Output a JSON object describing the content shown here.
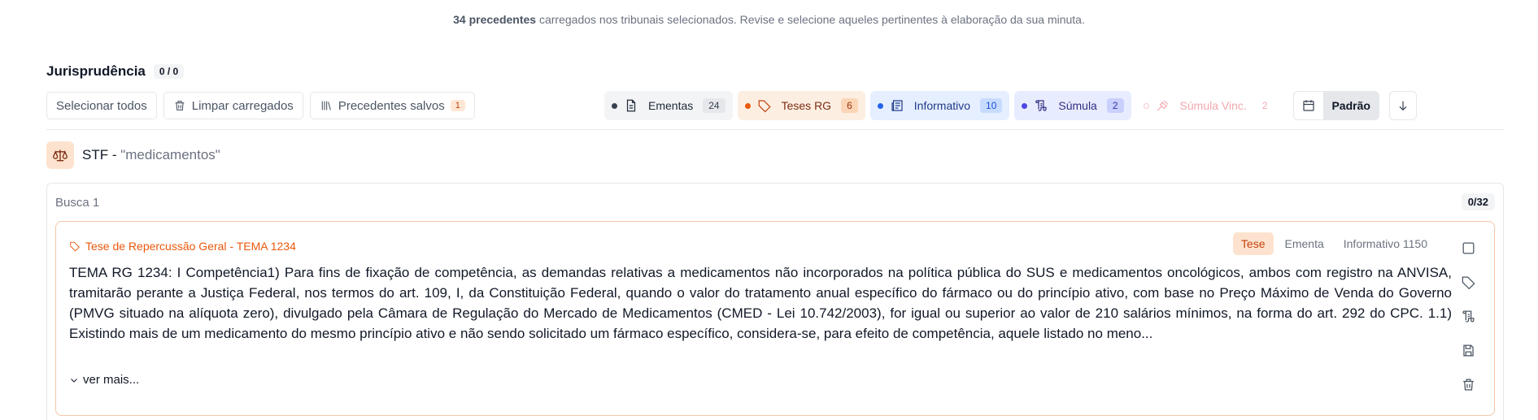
{
  "summary": {
    "count_text": "34 precedentes",
    "rest_text": " carregados nos tribunais selecionados. Revise e selecione aqueles pertinentes à elaboração da sua minuta."
  },
  "section": {
    "title": "Jurisprudência",
    "selected_count": "0 / 0"
  },
  "toolbar": {
    "select_all": "Selecionar todos",
    "clear_loaded": "Limpar carregados",
    "saved_precedents": "Precedentes salvos",
    "saved_count": "1"
  },
  "filters": [
    {
      "label": "Ementas",
      "count": "24",
      "icon": "document-icon"
    },
    {
      "label": "Teses RG",
      "count": "6",
      "icon": "tag-icon"
    },
    {
      "label": "Informativo",
      "count": "10",
      "icon": "newspaper-icon"
    },
    {
      "label": "Súmula",
      "count": "2",
      "icon": "scroll-icon"
    },
    {
      "label": "Súmula Vinc.",
      "count": "2",
      "icon": "gavel-icon"
    }
  ],
  "sort": {
    "mode": "Padrão"
  },
  "court": {
    "name": "STF",
    "separator": " - ",
    "query": "\"medicamentos\""
  },
  "busca": {
    "title": "Busca 1",
    "count": "0/32"
  },
  "card": {
    "tag": "Tese de Repercussão Geral - TEMA 1234",
    "tabs": [
      "Tese",
      "Ementa",
      "Informativo 1150"
    ],
    "active_tab": "Tese",
    "text": "TEMA RG 1234: I Competência1) Para fins de fixação de competência, as demandas relativas a medicamentos não incorporados na política pública do SUS e medicamentos oncológicos, ambos com registro na ANVISA, tramitarão perante a Justiça Federal, nos termos do art. 109, I, da Constituição Federal, quando o valor do tratamento anual específico do fármaco ou do princípio ativo, com base no Preço Máximo de Venda do Governo (PMVG situado na alíquota zero), divulgado pela Câmara de Regulação do Mercado de Medicamentos (CMED - Lei 10.742/2003), for igual ou superior ao valor de 210 salários mínimos, na forma do art. 292 do CPC. 1.1) Existindo mais de um medicamento do mesmo princípio ativo e não sendo solicitado um fármaco específico, considera-se, para efeito de competência, aquele listado no meno...",
    "see_more": "ver mais..."
  },
  "colors": {
    "accent_orange": "#ea580c",
    "border_orange": "#f5c6a5",
    "blue": "#2563eb",
    "indigo": "#4f46e5",
    "pink_muted": "#f0a8ae"
  }
}
